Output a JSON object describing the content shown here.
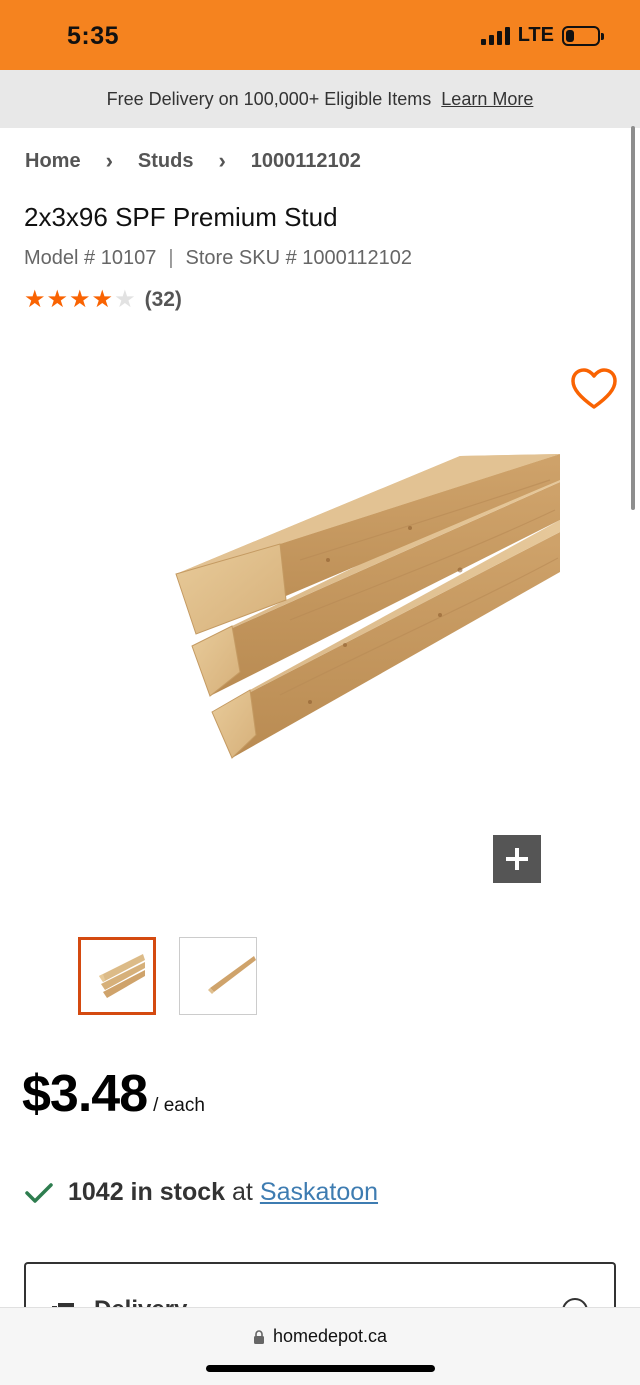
{
  "status_bar": {
    "time": "5:35",
    "network": "LTE",
    "battery_level": 0.25,
    "signal_bars": 4
  },
  "promo_banner": {
    "text": "Free Delivery on 100,000+ Eligible Items",
    "link_label": "Learn More"
  },
  "breadcrumb": {
    "items": [
      "Home",
      "Studs",
      "1000112102"
    ]
  },
  "product": {
    "title": "2x3x96 SPF Premium Stud",
    "model": "Model # 10107",
    "sku": "Store SKU # 1000112102",
    "rating_value": 4,
    "rating_max": 5,
    "review_count": "(32)"
  },
  "price": {
    "amount": "$3.48",
    "unit": "/ each"
  },
  "stock": {
    "count_text": "1042 in stock",
    "at": "at",
    "store": "Saskatoon"
  },
  "delivery": {
    "title": "Delivery"
  },
  "browser": {
    "url": "homedepot.ca"
  },
  "colors": {
    "brand_orange": "#f5831f",
    "star_orange": "#f96302",
    "check_green": "#2e7d4f",
    "link_blue": "#3e7cb1",
    "thumb_active_border": "#d44a10"
  }
}
